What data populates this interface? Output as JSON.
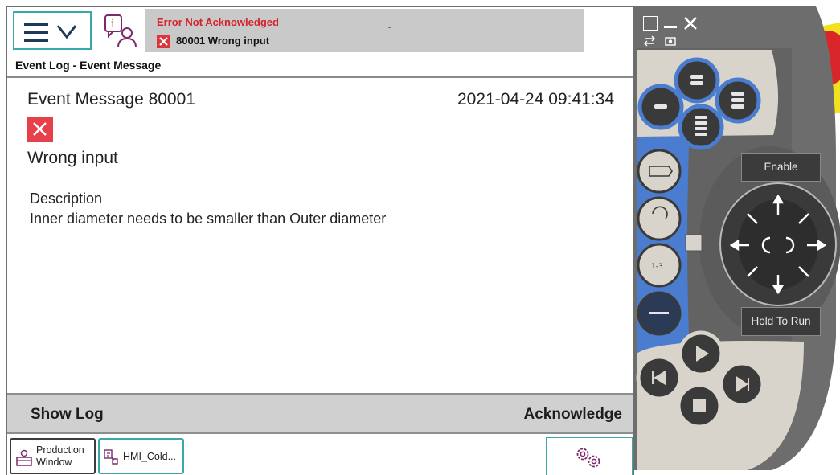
{
  "status": {
    "title": "Error Not Acknowledged",
    "message": "80001 Wrong input",
    "title_color": "#d4242b"
  },
  "breadcrumb": "Event Log - Event Message",
  "event": {
    "title": "Event Message 80001",
    "datetime": "2021-04-24 09:41:34",
    "subject": "Wrong input",
    "description_label": "Description",
    "description": "Inner diameter needs to be smaller than Outer diameter",
    "severity_icon": "error-x-icon",
    "severity_color": "#e6414b"
  },
  "actions": {
    "show_log": "Show Log",
    "acknowledge": "Acknowledge"
  },
  "taskbar": {
    "production_line1": "Production",
    "production_line2": "Window",
    "hmi": "HMI_Cold..."
  },
  "pendant": {
    "enable": "Enable",
    "hold_to_run": "Hold To Run"
  },
  "colors": {
    "accent": "#3aa9ab",
    "pendant_blue": "#4a7ccf",
    "pendant_body": "#6d6d6d",
    "emergency_red": "#d9262b",
    "emergency_yellow": "#f0e21f"
  }
}
